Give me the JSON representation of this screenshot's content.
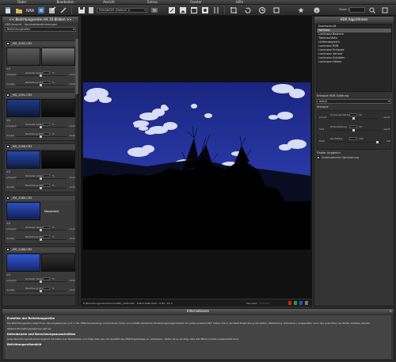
{
  "menu": [
    "Datei",
    "Bearbeiten",
    "Ansicht",
    "Extras",
    "Fenster",
    "Hilfe"
  ],
  "toolbar": {
    "preset": "ENHANCER (Default 1)",
    "zoom_label": "Zoom 100%"
  },
  "left_panel": {
    "header": "<< Belichtungsreihe mit 10 Bildern >>",
    "sub_label": "HDR-Ansicht · Kontrastbestimmungen",
    "dropdown": "Belichtungsreihe",
    "cards": [
      {
        "name": "_MG_2292.CR2",
        "ev": "±0",
        "strength": "50",
        "weight": "50",
        "tail": "hoch"
      },
      {
        "name": "_MG_2291.CR2",
        "ev": "±0",
        "strength": "50",
        "weight": "50",
        "tail": "hoch"
      },
      {
        "name": "_MG_2298.CR2",
        "ev": "±0",
        "strength": "50",
        "weight": "50",
        "tail": "hoch"
      },
      {
        "name": "_MG_2289.CR2",
        "ev": "±0",
        "strength": "50",
        "weight": "50",
        "tail": "hoch",
        "badge": "Masterbild"
      },
      {
        "name": "_MG_2288.CR2",
        "ev": "±0",
        "strength": "50",
        "weight": "50",
        "tail": "hoch"
      }
    ],
    "labels": {
      "row1_left": "schwach",
      "row1_name": "Globaler Gewicht",
      "row2_left": "dunkel",
      "row2_name": "Belichtung (EV)",
      "pct": "%"
    }
  },
  "status": {
    "path": "E:/Belichtungsreihe/Himmel/IMG_2289.CR2 · 3282×2460 Pixel · 8 Bit · EV 0",
    "fav": "Favoriten",
    "stars": "☆☆☆☆☆"
  },
  "right_panel": {
    "header": "HDR Algorithmen",
    "algos": [
      "Durchschnitt",
      "Kontrast",
      "Luminanz Balance",
      "Tiefenschärfe",
      "Lichterabgleich",
      "Luminanz RGB",
      "Luminanz Entropie",
      "Luminanz Verlauf",
      "Luminanz Schatten",
      "Luminanz Höhen"
    ],
    "selected_index": 1,
    "smoothing_title": "Entropie HDR-Glättung",
    "smoothing_value": "weich",
    "entropy_title": "Entropie",
    "rows": [
      {
        "l": "scharf",
        "n": "Entropieschärfe",
        "v": "50",
        "t": "weich"
      },
      {
        "l": "hart",
        "n": "HDR-Glättung",
        "v": "50",
        "t": "weich"
      },
      {
        "l": "flach",
        "n": "Nachtfilter",
        "v": "100",
        "t": "tief"
      }
    ],
    "finish_title": "Finaler Ausgleich",
    "finish_check": "Automatische Optimierung"
  },
  "info": {
    "header": "Informationen",
    "title": "Erstellen der Belichtungsreihe",
    "p1": "Die Belichtungsreihe zeigt Ihnen die eingelesenen und in der HDR-Verarbeitung vorhandenen Fotos und enthält zahlreiche Einstellungsmöglichkeiten für jedes einzelne Bild. Haben Sie in der RAW-Entwicklung die Option »Belichtung optimieren« ausgewählt, kann das Ausrichten der Bilder erhalten werden.",
    "p2": "Weitere Einstellungsoptionen gibt es:",
    "h2": "Datenbaume und Berechnungsausschnitten",
    "p3": "Jedes Belichtungsreihenbild ergänzt die Daten des Masterbilds und trägt dazu bei, die Qualität des HDR-Ergebnisses zu verbessern. Daher ist es wichtig, dass alle Bilder korrekt ausgerichtet sind.",
    "h3": "Belichtungsreihenbild"
  }
}
